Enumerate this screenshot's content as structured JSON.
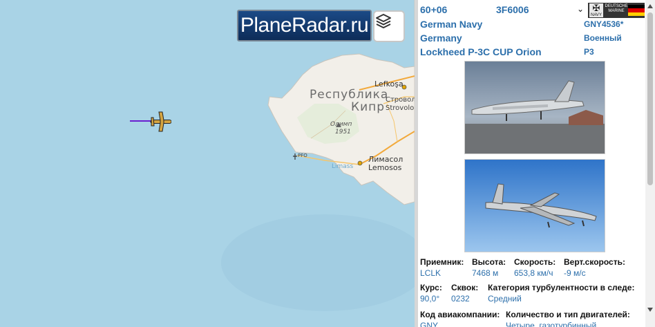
{
  "map": {
    "logo_text": "PlaneRadar.ru",
    "layers_icon": "layers-icon",
    "labels": {
      "country_line1": "Республика",
      "country_line2": "Кипр",
      "lefkosa": "Lefkoşa",
      "strovolos_ru": "Строволо",
      "strovolos": "Strovolo",
      "olymp": "Олимп",
      "olymp_elev": "1951",
      "pfo": "PFO",
      "limassol_bay": "Limass",
      "limassol_ru": "Лимасол",
      "limassol": "Lemosos"
    },
    "colors": {
      "sea": "#a9d3e6",
      "land": "#f2efe9",
      "track": "#6a1fcf",
      "aircraft": "#d4a442"
    }
  },
  "panel": {
    "registration": "60+06",
    "hex": "3F6006",
    "callsign": "GNY4536*",
    "operator": "German Navy",
    "category": "Военный",
    "country": "Germany",
    "type_code": "P3",
    "model": "Lockheed P-3C CUP Orion",
    "badge_text": "DEUTSCHE MARINE",
    "badge_navy": "NAVY",
    "photos": [
      "photo-1",
      "photo-2"
    ],
    "stats": {
      "receiver_label": "Приемник:",
      "receiver": "LCLK",
      "altitude_label": "Высота:",
      "altitude": "7468 м",
      "speed_label": "Скорость:",
      "speed": "653,8 км/ч",
      "vspeed_label": "Верт.скорость:",
      "vspeed": "-9 м/с",
      "course_label": "Курс:",
      "course": "90,0°",
      "squawk_label": "Сквок:",
      "squawk": "0232",
      "wake_label": "Категория турбулентности в следе:",
      "wake": "Средний",
      "airline_label": "Код авиакомпании:",
      "airline": "GNY",
      "engines_label": "Количество и тип двигателей:",
      "engines": "Четыре, газотурбинный"
    }
  }
}
